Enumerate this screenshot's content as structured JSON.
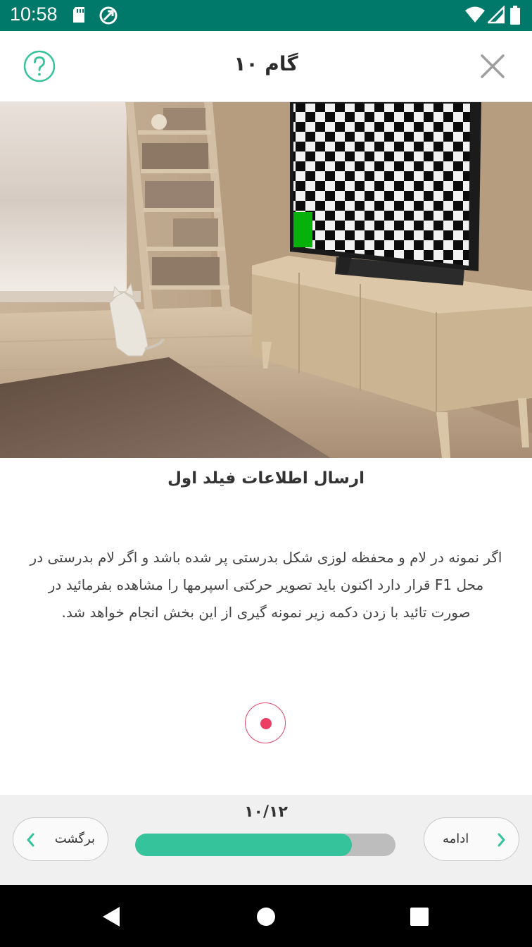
{
  "status_bar": {
    "time": "10:58",
    "icons": [
      "sd-card-icon",
      "sync-icon",
      "wifi-icon",
      "signal-icon",
      "battery-icon"
    ]
  },
  "header": {
    "title": "گام ۱۰",
    "help_icon": "help-circle-icon",
    "close_icon": "close-icon"
  },
  "hero": {
    "description_icon": "room-with-tv-checkerboard-illustration"
  },
  "content": {
    "title": "ارسال اطلاعات فیلد اول",
    "body": "اگر نمونه در لام و محفظه لوزی شکل بدرستی پر شده باشد و اگر لام بدرستی در محل F1 قرار دارد اکنون باید تصویر حرکتی اسپرمها را مشاهده بفرمائید در صورت تائید با زدن دکمه زیر نمونه گیری از این بخش انجام خواهد شد."
  },
  "navigation": {
    "step_counter": "۱۰/۱۲",
    "progress": 0.8333,
    "back_label": "برگشت",
    "next_label": "ادامه"
  },
  "colors": {
    "status_bar": "#00796b",
    "accent": "#35c39c",
    "record": "#ec3d63"
  }
}
